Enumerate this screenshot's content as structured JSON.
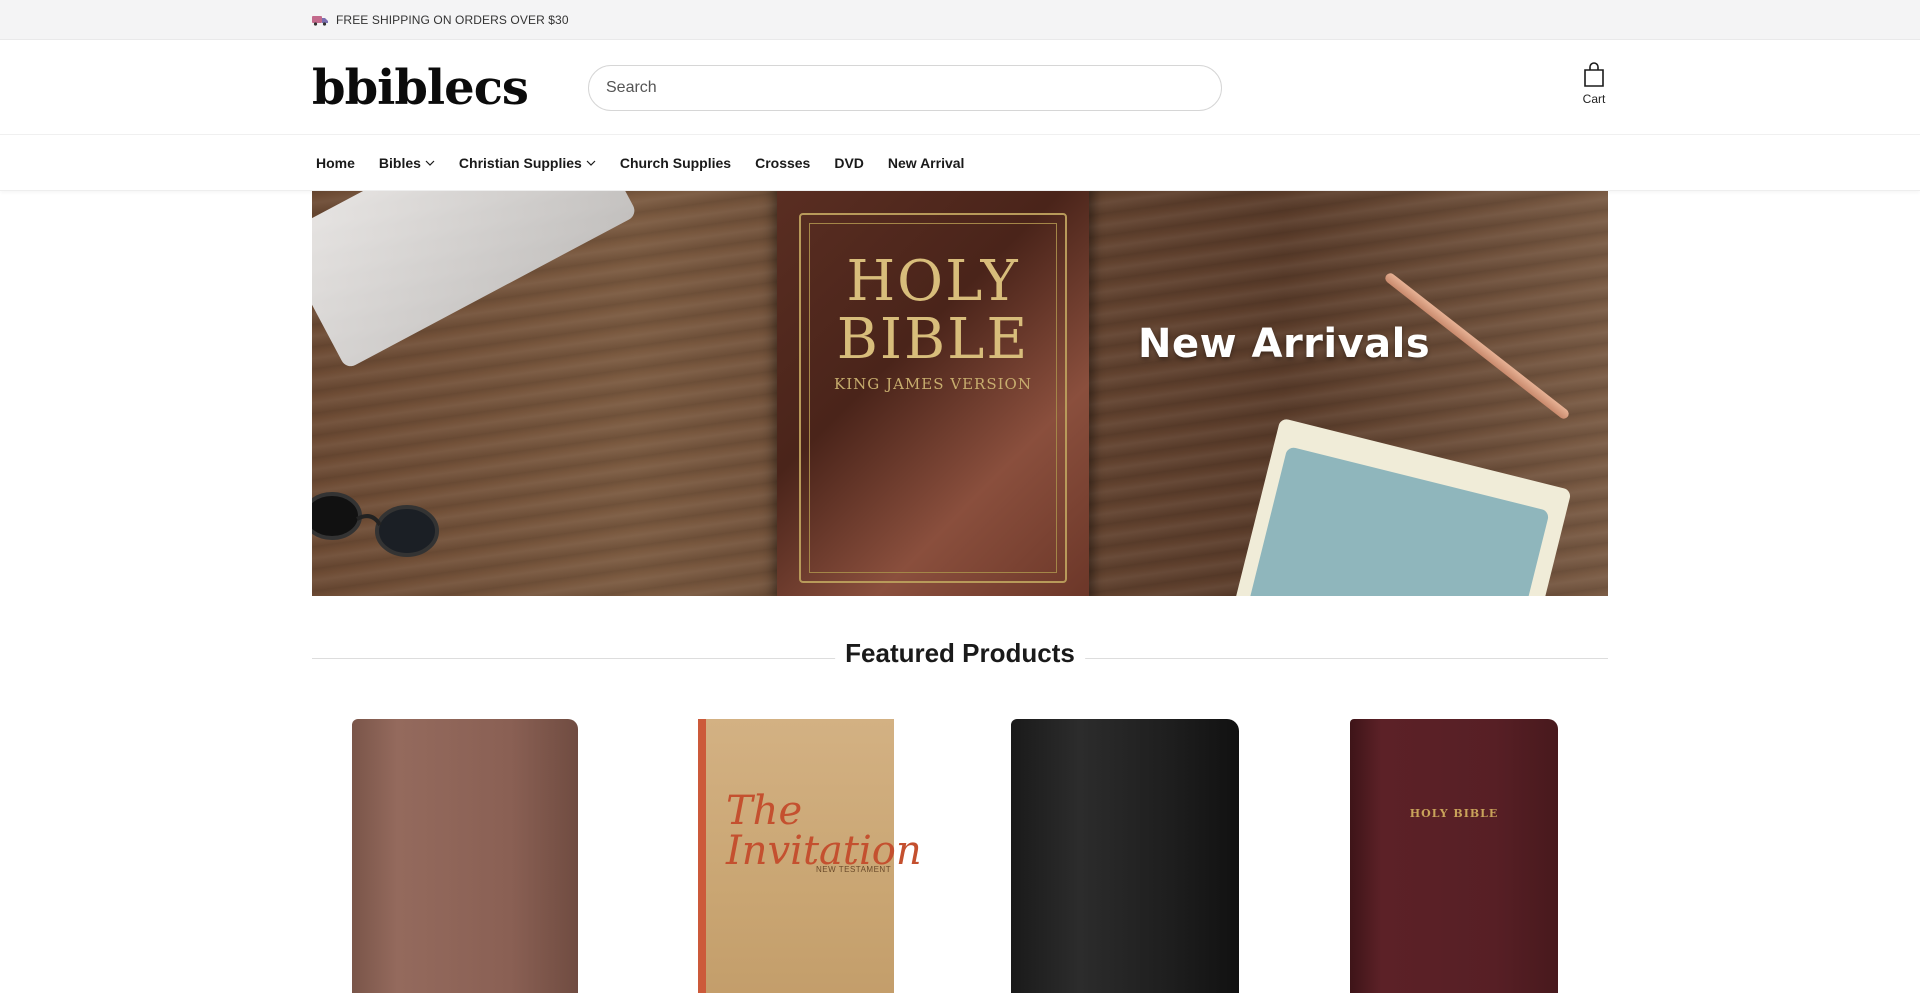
{
  "announcement": {
    "icon": "truck-icon",
    "text": "FREE SHIPPING ON ORDERS OVER $30"
  },
  "header": {
    "logo": "bbiblecs",
    "search_placeholder": "Search",
    "cart_label": "Cart"
  },
  "nav": {
    "items": [
      {
        "label": "Home",
        "has_dropdown": false
      },
      {
        "label": "Bibles",
        "has_dropdown": true
      },
      {
        "label": "Christian Supplies",
        "has_dropdown": true
      },
      {
        "label": "Church Supplies",
        "has_dropdown": false
      },
      {
        "label": "Crosses",
        "has_dropdown": false
      },
      {
        "label": "DVD",
        "has_dropdown": false
      },
      {
        "label": "New Arrival",
        "has_dropdown": false
      }
    ]
  },
  "hero": {
    "heading": "New Arrivals",
    "bible_title_line1": "HOLY",
    "bible_title_line2": "BIBLE",
    "bible_subtitle": "KING JAMES VERSION"
  },
  "featured": {
    "title": "Featured Products"
  },
  "products": [
    {
      "cover_color": "#8a6054"
    },
    {
      "cover_color": "#c9a572",
      "cover_title": "The Invitation",
      "cover_subtitle": "NEW TESTAMENT"
    },
    {
      "cover_color": "#1e1e1e"
    },
    {
      "cover_color": "#571f25",
      "cover_title": "HOLY BIBLE"
    }
  ],
  "colors": {
    "announcement_bg": "#f4f4f5",
    "hero_text": "#ffffff"
  }
}
